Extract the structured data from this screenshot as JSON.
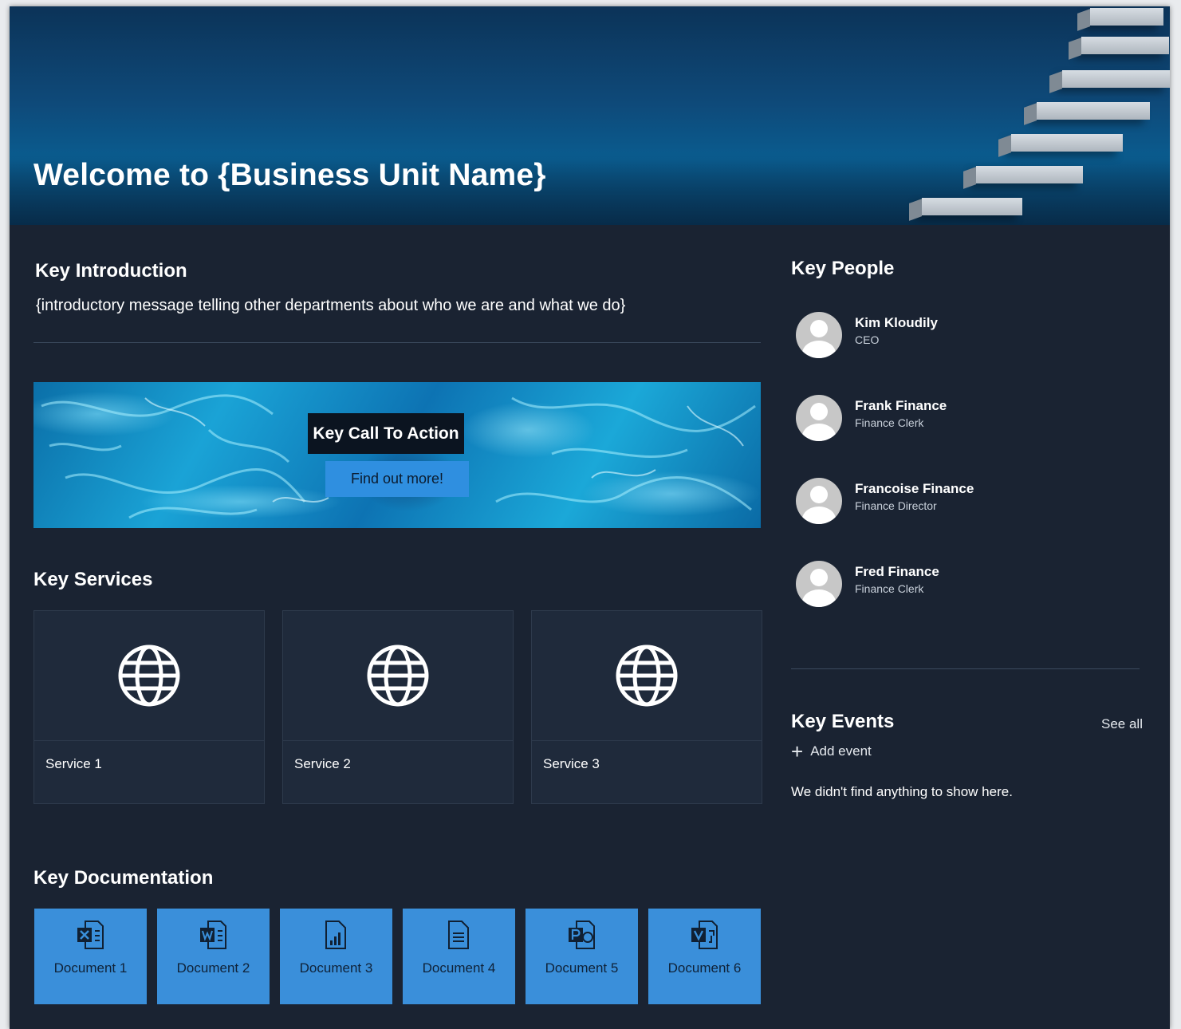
{
  "hero": {
    "title": "Welcome to {Business Unit Name}"
  },
  "intro": {
    "heading": "Key Introduction",
    "text": "{introductory message telling other departments about who we are and what we do}"
  },
  "cta": {
    "heading": "Key Call To Action",
    "button_label": "Find out more!"
  },
  "services": {
    "heading": "Key Services",
    "items": [
      {
        "label": "Service 1",
        "icon": "globe-icon"
      },
      {
        "label": "Service 2",
        "icon": "globe-icon"
      },
      {
        "label": "Service 3",
        "icon": "globe-icon"
      }
    ]
  },
  "documentation": {
    "heading": "Key Documentation",
    "items": [
      {
        "label": "Document 1",
        "icon": "excel-file-icon"
      },
      {
        "label": "Document 2",
        "icon": "word-file-icon"
      },
      {
        "label": "Document 3",
        "icon": "chart-file-icon"
      },
      {
        "label": "Document 4",
        "icon": "text-file-icon"
      },
      {
        "label": "Document 5",
        "icon": "powerpoint-file-icon"
      },
      {
        "label": "Document 6",
        "icon": "visio-file-icon"
      }
    ]
  },
  "people": {
    "heading": "Key People",
    "items": [
      {
        "name": "Kim Kloudily",
        "role": "CEO"
      },
      {
        "name": "Frank Finance",
        "role": "Finance Clerk"
      },
      {
        "name": "Francoise Finance",
        "role": "Finance Director"
      },
      {
        "name": "Fred Finance",
        "role": "Finance Clerk"
      }
    ]
  },
  "events": {
    "heading": "Key Events",
    "see_all": "See all",
    "add_event": "Add event",
    "empty_message": "We didn't find anything to show here."
  },
  "colors": {
    "page_background": "#1a2332",
    "card_background": "#1f2a3b",
    "accent_blue": "#3a8fda",
    "cta_heading_background": "#0b1420"
  }
}
